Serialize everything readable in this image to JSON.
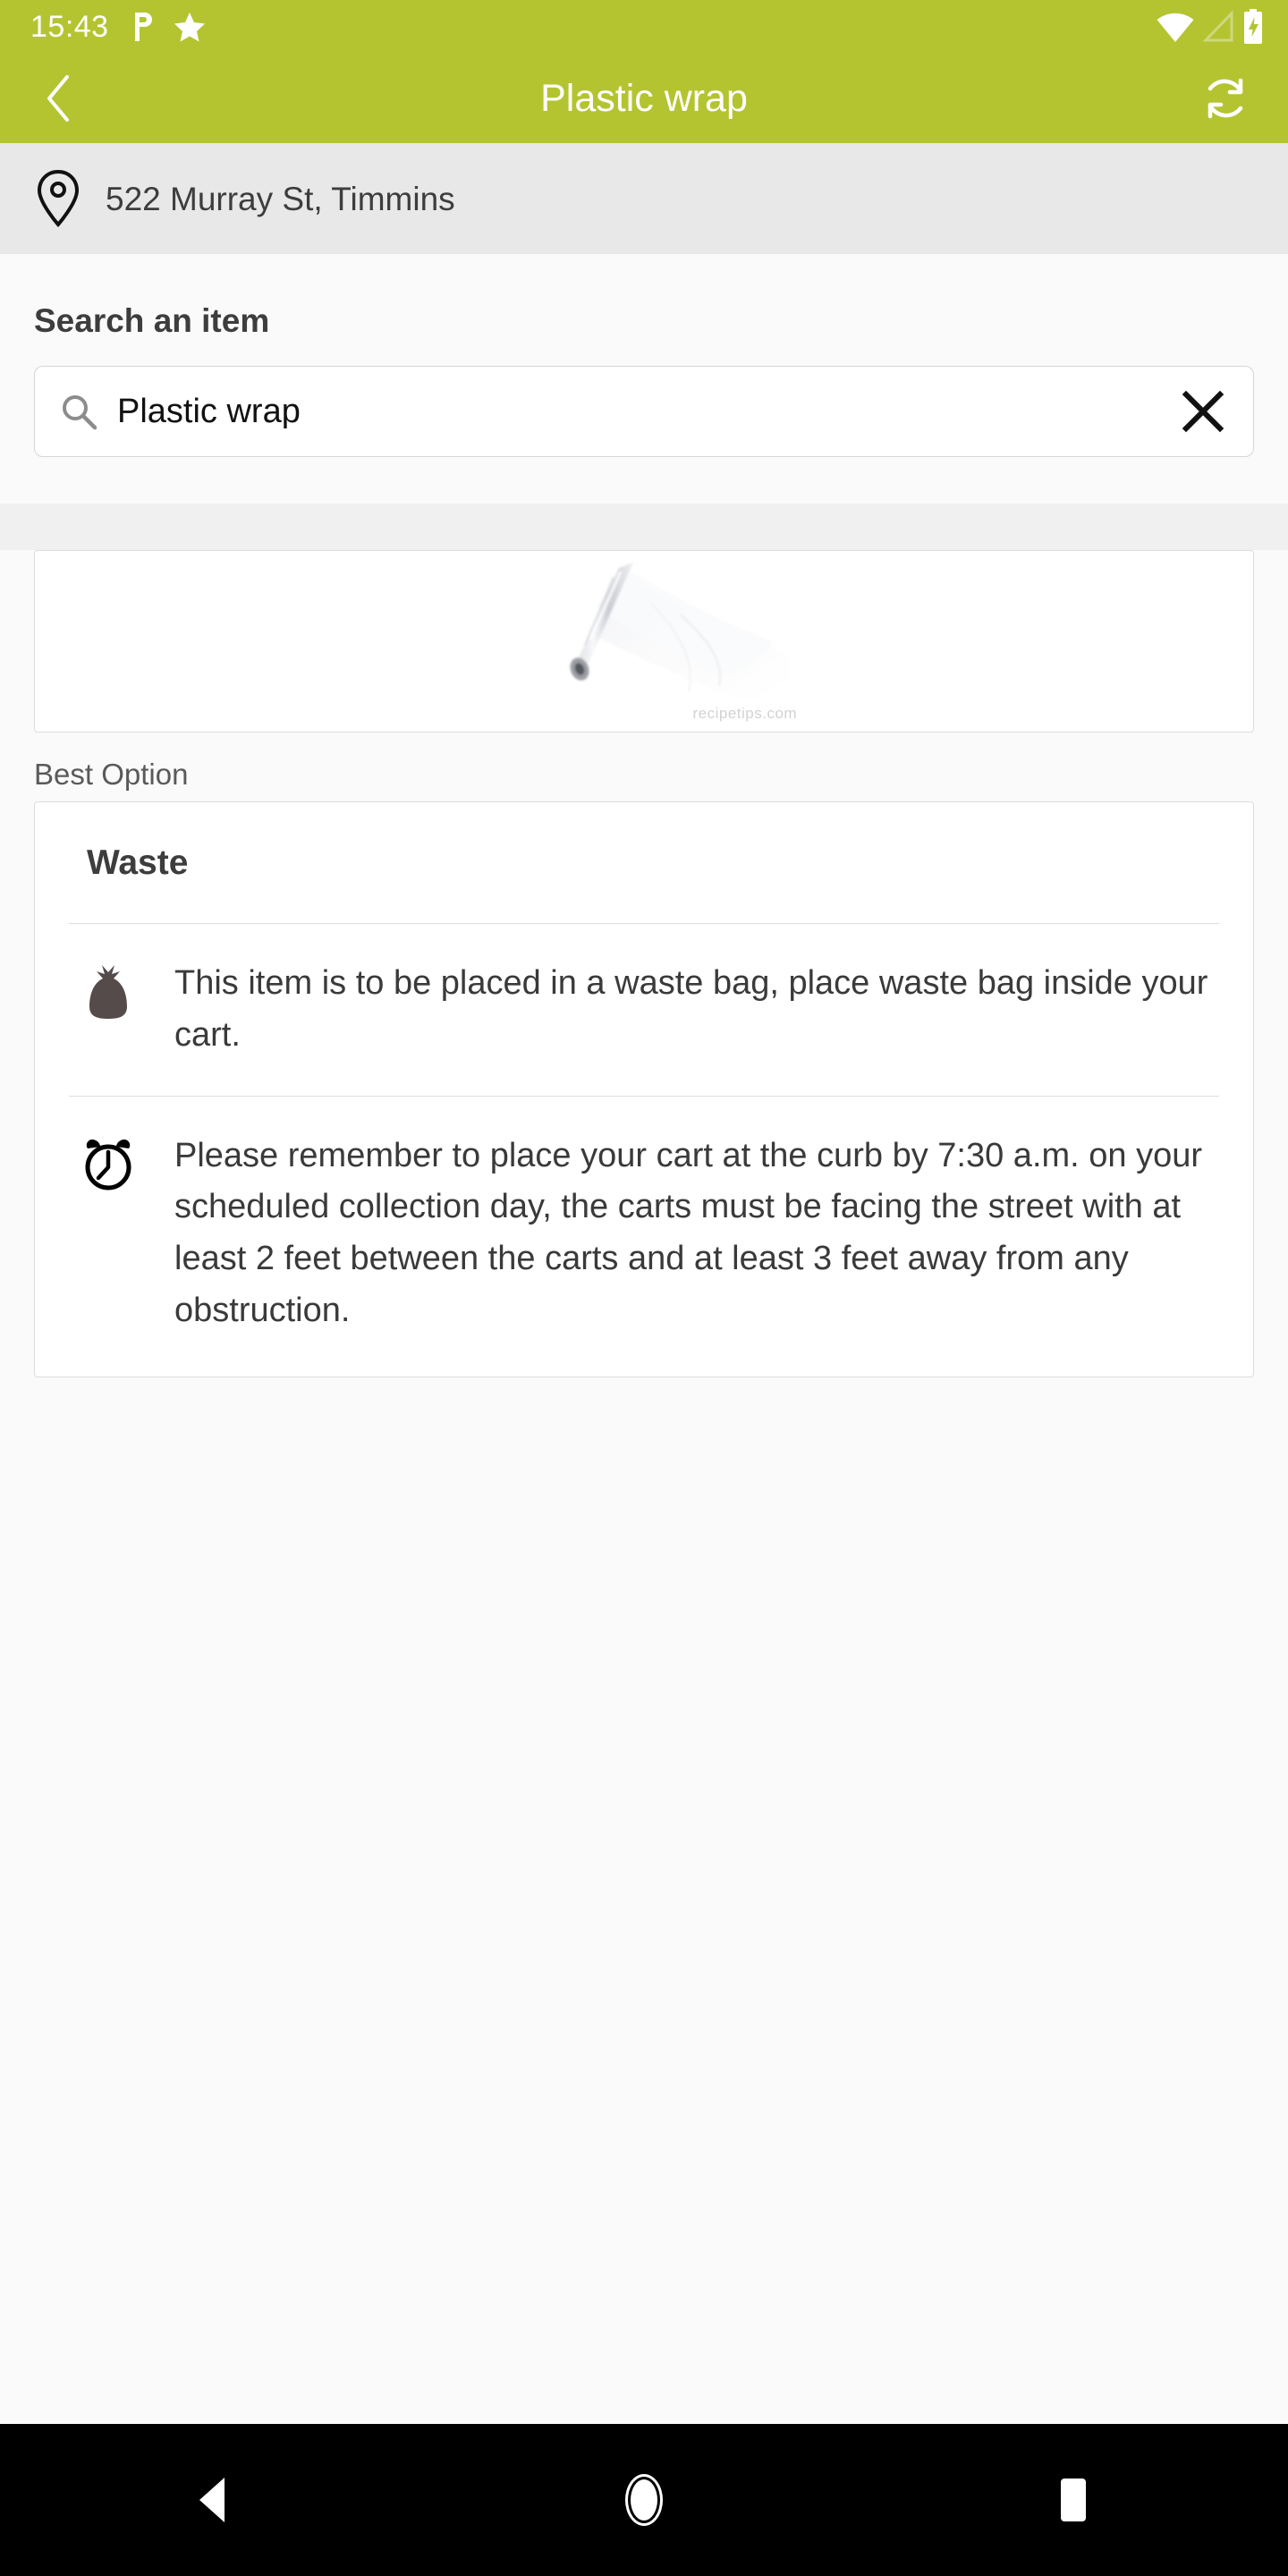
{
  "status_bar": {
    "time": "15:43",
    "left_icons": [
      "parking-p-icon",
      "star-icon"
    ],
    "right_icons": [
      "wifi-icon",
      "cell-signal-icon",
      "battery-charging-icon"
    ],
    "background_color": "#b4c431",
    "foreground_color": "#ffffff"
  },
  "app_bar": {
    "title": "Plastic wrap",
    "back_icon": "chevron-left-icon",
    "refresh_icon": "refresh-icon",
    "background_color": "#b4c431"
  },
  "location": {
    "icon": "map-pin-icon",
    "address": "522 Murray St, Timmins",
    "background_color": "#e8e8e8"
  },
  "search": {
    "label": "Search an item",
    "icon": "search-icon",
    "value": "Plastic wrap",
    "placeholder": "Search an item",
    "clear_icon": "close-icon"
  },
  "item_image": {
    "name": "plastic-wrap-roll-photo",
    "watermark": "recipetips.com"
  },
  "result": {
    "section_label": "Best Option",
    "title": "Waste",
    "rows": [
      {
        "icon": "garbage-bag-icon",
        "text": "This item is to be placed in a waste bag, place waste bag inside your cart."
      },
      {
        "icon": "alarm-clock-icon",
        "text": "Please remember to place your cart at the curb by 7:30 a.m. on your scheduled collection day, the carts must be facing the street with at least 2 feet between the carts and at least 3 feet away from any obstruction."
      }
    ]
  },
  "nav_bar": {
    "back_label": "back-triangle-icon",
    "home_label": "home-circle-icon",
    "recents_label": "recents-square-icon",
    "background_color": "#000000"
  }
}
